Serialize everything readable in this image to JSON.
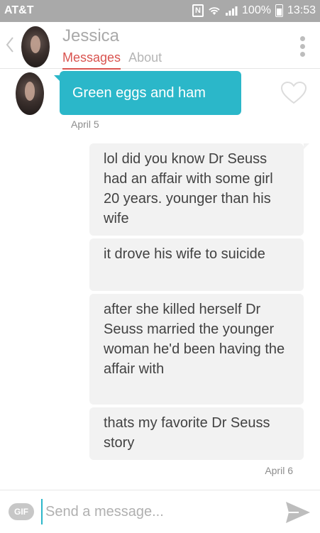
{
  "status_bar": {
    "carrier": "AT&T",
    "nfc": "N",
    "battery": "100%",
    "time": "13:53"
  },
  "header": {
    "name": "Jessica",
    "tabs": [
      "Messages",
      "About"
    ]
  },
  "messages": [
    {
      "from": "Jessica",
      "text": "Green eggs and ham"
    },
    {
      "from": "me",
      "text": "lol did you know Dr Seuss had an affair with some girl 20 years. younger than his wife"
    },
    {
      "from": "me",
      "text": "it drove his wife to suicide"
    },
    {
      "from": "me",
      "text": "after she killed herself Dr Seuss married the younger woman he'd been having the affair with"
    },
    {
      "from": "me",
      "text": "thats my favorite Dr Seuss story"
    }
  ],
  "dates": {
    "first": "April 5",
    "second": "April 6"
  },
  "composer": {
    "gif_label": "GIF",
    "placeholder": "Send a message..."
  },
  "colors": {
    "accent_teal": "#2bb7c9",
    "tab_active_red": "#d9534f",
    "status_bar_gray": "#a9a9a9"
  }
}
